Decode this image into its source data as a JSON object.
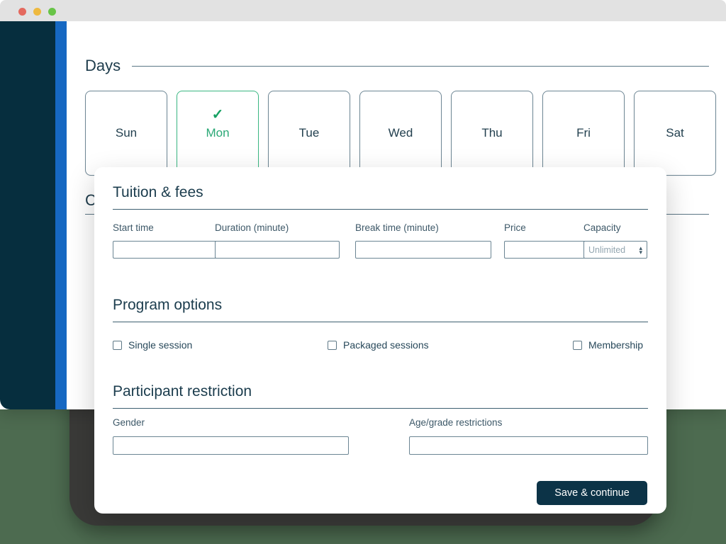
{
  "window": {
    "traffic_lights": [
      "close",
      "minimize",
      "zoom"
    ],
    "colors": {
      "titlebar": "#e2e2e2",
      "sidebar_dark": "#062e3e",
      "sidebar_accent": "#1668c2",
      "page_background": "#4d6b50",
      "device_frame": "#3a3a38",
      "accent_green": "#2aa876",
      "primary_dark": "#0c3347"
    }
  },
  "page": {
    "days_section": {
      "title": "Days",
      "days": [
        {
          "label": "Sun",
          "selected": false
        },
        {
          "label": "Mon",
          "selected": true
        },
        {
          "label": "Tue",
          "selected": false
        },
        {
          "label": "Wed",
          "selected": false
        },
        {
          "label": "Thu",
          "selected": false
        },
        {
          "label": "Fri",
          "selected": false
        },
        {
          "label": "Sat",
          "selected": false
        }
      ],
      "check_glyph": "✓"
    },
    "next_section_peek": "C"
  },
  "modal": {
    "tuition": {
      "title": "Tuition & fees",
      "fields": {
        "start_time": {
          "label": "Start time",
          "value": "",
          "placeholder": "",
          "addon_icon": "clock-icon"
        },
        "duration": {
          "label": "Duration (minute)",
          "value": "",
          "placeholder": ""
        },
        "break_time": {
          "label": "Break time (minute)",
          "value": "",
          "placeholder": ""
        },
        "price": {
          "label": "Price",
          "value": "",
          "placeholder": "",
          "addon_symbol": "$"
        },
        "capacity": {
          "label": "Capacity",
          "value": "",
          "placeholder": "Unlimited",
          "spinner_up": "▴",
          "spinner_down": "▾"
        }
      }
    },
    "program_options": {
      "title": "Program options",
      "options": [
        {
          "label": "Single session",
          "checked": false
        },
        {
          "label": "Packaged sessions",
          "checked": false
        },
        {
          "label": "Membership",
          "checked": false
        }
      ]
    },
    "participant_restriction": {
      "title": "Participant restriction",
      "fields": {
        "gender": {
          "label": "Gender",
          "value": "",
          "placeholder": ""
        },
        "age_grade": {
          "label": "Age/grade restrictions",
          "value": "",
          "placeholder": ""
        }
      }
    },
    "footer": {
      "save_label": "Save & continue"
    }
  }
}
